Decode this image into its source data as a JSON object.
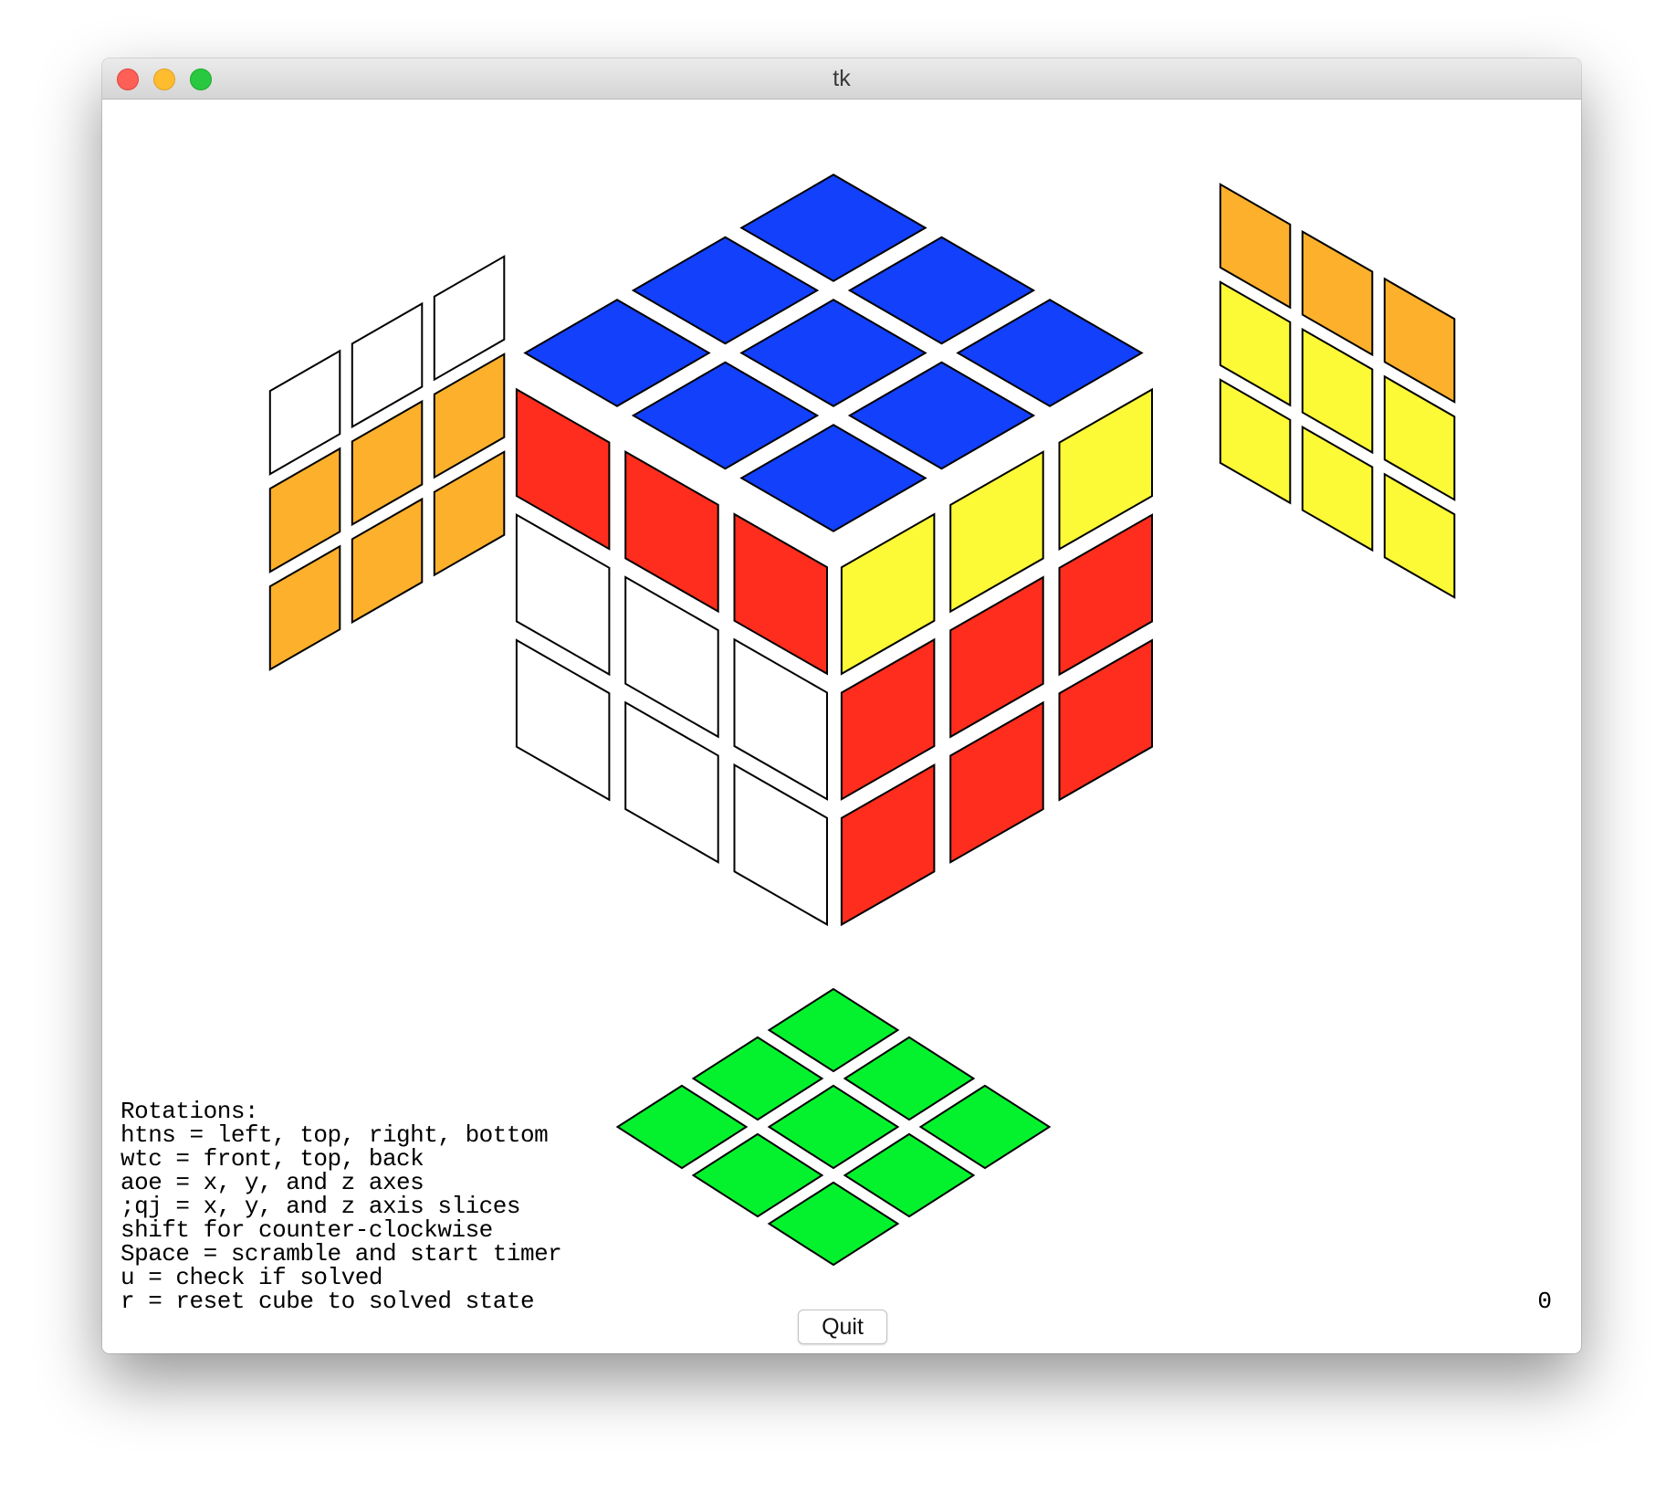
{
  "window": {
    "title": "tk"
  },
  "colors": {
    "blue": "#1240fb",
    "red": "#fe2d1e",
    "white": "#ffffff",
    "yellow": "#fcf937",
    "orange": "#fcb02b",
    "green": "#04f22d"
  },
  "cube": {
    "top": [
      [
        "blue",
        "blue",
        "blue"
      ],
      [
        "blue",
        "blue",
        "blue"
      ],
      [
        "blue",
        "blue",
        "blue"
      ]
    ],
    "front": [
      [
        "red",
        "red",
        "red"
      ],
      [
        "white",
        "white",
        "white"
      ],
      [
        "white",
        "white",
        "white"
      ]
    ],
    "right": [
      [
        "yellow",
        "yellow",
        "yellow"
      ],
      [
        "red",
        "red",
        "red"
      ],
      [
        "red",
        "red",
        "red"
      ]
    ],
    "left_panel": [
      [
        "white",
        "white",
        "white"
      ],
      [
        "orange",
        "orange",
        "orange"
      ],
      [
        "orange",
        "orange",
        "orange"
      ]
    ],
    "right_panel": [
      [
        "orange",
        "orange",
        "orange"
      ],
      [
        "yellow",
        "yellow",
        "yellow"
      ],
      [
        "yellow",
        "yellow",
        "yellow"
      ]
    ],
    "bottom_panel": [
      [
        "green",
        "green",
        "green"
      ],
      [
        "green",
        "green",
        "green"
      ],
      [
        "green",
        "green",
        "green"
      ]
    ]
  },
  "instructions": [
    "Rotations:",
    "htns = left, top, right, bottom",
    "wtc = front, top, back",
    "aoe = x, y, and z axes",
    ";qj = x, y, and z axis slices",
    "shift for counter-clockwise",
    "Space = scramble and start timer",
    "u = check if solved",
    "r = reset cube to solved state"
  ],
  "timer": "0",
  "quit_label": "Quit"
}
